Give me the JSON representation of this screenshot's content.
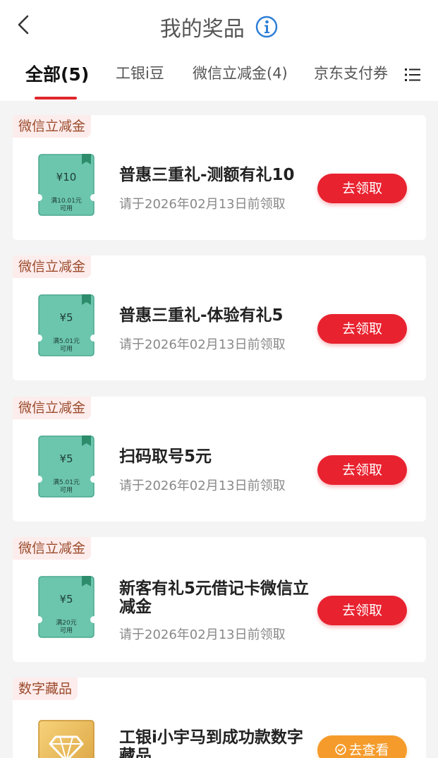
{
  "header": {
    "title": "我的奖品",
    "back_icon": "chevron-left-icon",
    "info_icon": "info-icon"
  },
  "tabs": [
    {
      "label": "全部(5)",
      "active": true
    },
    {
      "label": "工银i豆",
      "active": false
    },
    {
      "label": "微信立减金(4)",
      "active": false
    },
    {
      "label": "京东支付券",
      "active": false
    }
  ],
  "tab_menu_icon": "list-icon",
  "colors": {
    "accent": "#e0262b",
    "button_red": "#e8222f",
    "button_orange": "#f59b2b",
    "coupon_green": "#6cc6ad",
    "tag_bg": "#fdecec"
  },
  "prizes": [
    {
      "tag": "微信立减金",
      "coupon_amount": "¥10",
      "coupon_condition": "满10.01元",
      "coupon_use": "可用",
      "name": "普惠三重礼-测额有礼10",
      "date": "请于2026年02月13日前领取",
      "button": "去领取"
    },
    {
      "tag": "微信立减金",
      "coupon_amount": "¥5",
      "coupon_condition": "满5.01元",
      "coupon_use": "可用",
      "name": "普惠三重礼-体验有礼5",
      "date": "请于2026年02月13日前领取",
      "button": "去领取"
    },
    {
      "tag": "微信立减金",
      "coupon_amount": "¥5",
      "coupon_condition": "满5.01元",
      "coupon_use": "可用",
      "name": "扫码取号5元",
      "date": "请于2026年02月13日前领取",
      "button": "去领取"
    },
    {
      "tag": "微信立减金",
      "coupon_amount": "¥5",
      "coupon_condition": "满20元",
      "coupon_use": "可用",
      "name": "新客有礼5元借记卡微信立减金",
      "date": "请于2026年02月13日前领取",
      "button": "去领取"
    },
    {
      "tag": "数字藏品",
      "name": "工银i小宇马到成功款数字藏品",
      "button": "去查看",
      "button_icon": "check-circle-icon"
    }
  ]
}
